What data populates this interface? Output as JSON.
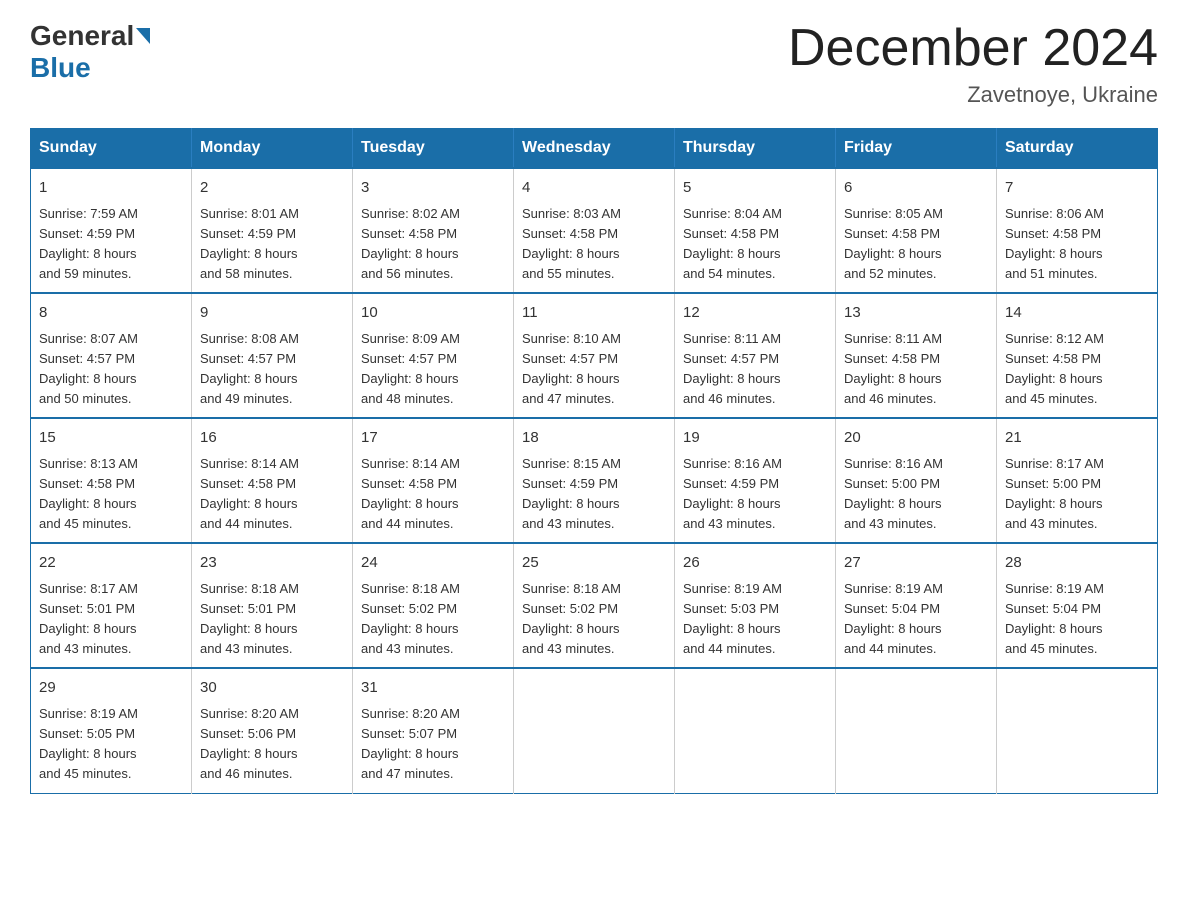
{
  "header": {
    "logo_general": "General",
    "logo_blue": "Blue",
    "month_title": "December 2024",
    "location": "Zavetnoye, Ukraine"
  },
  "days_of_week": [
    "Sunday",
    "Monday",
    "Tuesday",
    "Wednesday",
    "Thursday",
    "Friday",
    "Saturday"
  ],
  "weeks": [
    [
      {
        "day": "1",
        "sunrise": "7:59 AM",
        "sunset": "4:59 PM",
        "daylight": "8 hours and 59 minutes."
      },
      {
        "day": "2",
        "sunrise": "8:01 AM",
        "sunset": "4:59 PM",
        "daylight": "8 hours and 58 minutes."
      },
      {
        "day": "3",
        "sunrise": "8:02 AM",
        "sunset": "4:58 PM",
        "daylight": "8 hours and 56 minutes."
      },
      {
        "day": "4",
        "sunrise": "8:03 AM",
        "sunset": "4:58 PM",
        "daylight": "8 hours and 55 minutes."
      },
      {
        "day": "5",
        "sunrise": "8:04 AM",
        "sunset": "4:58 PM",
        "daylight": "8 hours and 54 minutes."
      },
      {
        "day": "6",
        "sunrise": "8:05 AM",
        "sunset": "4:58 PM",
        "daylight": "8 hours and 52 minutes."
      },
      {
        "day": "7",
        "sunrise": "8:06 AM",
        "sunset": "4:58 PM",
        "daylight": "8 hours and 51 minutes."
      }
    ],
    [
      {
        "day": "8",
        "sunrise": "8:07 AM",
        "sunset": "4:57 PM",
        "daylight": "8 hours and 50 minutes."
      },
      {
        "day": "9",
        "sunrise": "8:08 AM",
        "sunset": "4:57 PM",
        "daylight": "8 hours and 49 minutes."
      },
      {
        "day": "10",
        "sunrise": "8:09 AM",
        "sunset": "4:57 PM",
        "daylight": "8 hours and 48 minutes."
      },
      {
        "day": "11",
        "sunrise": "8:10 AM",
        "sunset": "4:57 PM",
        "daylight": "8 hours and 47 minutes."
      },
      {
        "day": "12",
        "sunrise": "8:11 AM",
        "sunset": "4:57 PM",
        "daylight": "8 hours and 46 minutes."
      },
      {
        "day": "13",
        "sunrise": "8:11 AM",
        "sunset": "4:58 PM",
        "daylight": "8 hours and 46 minutes."
      },
      {
        "day": "14",
        "sunrise": "8:12 AM",
        "sunset": "4:58 PM",
        "daylight": "8 hours and 45 minutes."
      }
    ],
    [
      {
        "day": "15",
        "sunrise": "8:13 AM",
        "sunset": "4:58 PM",
        "daylight": "8 hours and 45 minutes."
      },
      {
        "day": "16",
        "sunrise": "8:14 AM",
        "sunset": "4:58 PM",
        "daylight": "8 hours and 44 minutes."
      },
      {
        "day": "17",
        "sunrise": "8:14 AM",
        "sunset": "4:58 PM",
        "daylight": "8 hours and 44 minutes."
      },
      {
        "day": "18",
        "sunrise": "8:15 AM",
        "sunset": "4:59 PM",
        "daylight": "8 hours and 43 minutes."
      },
      {
        "day": "19",
        "sunrise": "8:16 AM",
        "sunset": "4:59 PM",
        "daylight": "8 hours and 43 minutes."
      },
      {
        "day": "20",
        "sunrise": "8:16 AM",
        "sunset": "5:00 PM",
        "daylight": "8 hours and 43 minutes."
      },
      {
        "day": "21",
        "sunrise": "8:17 AM",
        "sunset": "5:00 PM",
        "daylight": "8 hours and 43 minutes."
      }
    ],
    [
      {
        "day": "22",
        "sunrise": "8:17 AM",
        "sunset": "5:01 PM",
        "daylight": "8 hours and 43 minutes."
      },
      {
        "day": "23",
        "sunrise": "8:18 AM",
        "sunset": "5:01 PM",
        "daylight": "8 hours and 43 minutes."
      },
      {
        "day": "24",
        "sunrise": "8:18 AM",
        "sunset": "5:02 PM",
        "daylight": "8 hours and 43 minutes."
      },
      {
        "day": "25",
        "sunrise": "8:18 AM",
        "sunset": "5:02 PM",
        "daylight": "8 hours and 43 minutes."
      },
      {
        "day": "26",
        "sunrise": "8:19 AM",
        "sunset": "5:03 PM",
        "daylight": "8 hours and 44 minutes."
      },
      {
        "day": "27",
        "sunrise": "8:19 AM",
        "sunset": "5:04 PM",
        "daylight": "8 hours and 44 minutes."
      },
      {
        "day": "28",
        "sunrise": "8:19 AM",
        "sunset": "5:04 PM",
        "daylight": "8 hours and 45 minutes."
      }
    ],
    [
      {
        "day": "29",
        "sunrise": "8:19 AM",
        "sunset": "5:05 PM",
        "daylight": "8 hours and 45 minutes."
      },
      {
        "day": "30",
        "sunrise": "8:20 AM",
        "sunset": "5:06 PM",
        "daylight": "8 hours and 46 minutes."
      },
      {
        "day": "31",
        "sunrise": "8:20 AM",
        "sunset": "5:07 PM",
        "daylight": "8 hours and 47 minutes."
      },
      null,
      null,
      null,
      null
    ]
  ],
  "labels": {
    "sunrise_prefix": "Sunrise: ",
    "sunset_prefix": "Sunset: ",
    "daylight_prefix": "Daylight: "
  }
}
